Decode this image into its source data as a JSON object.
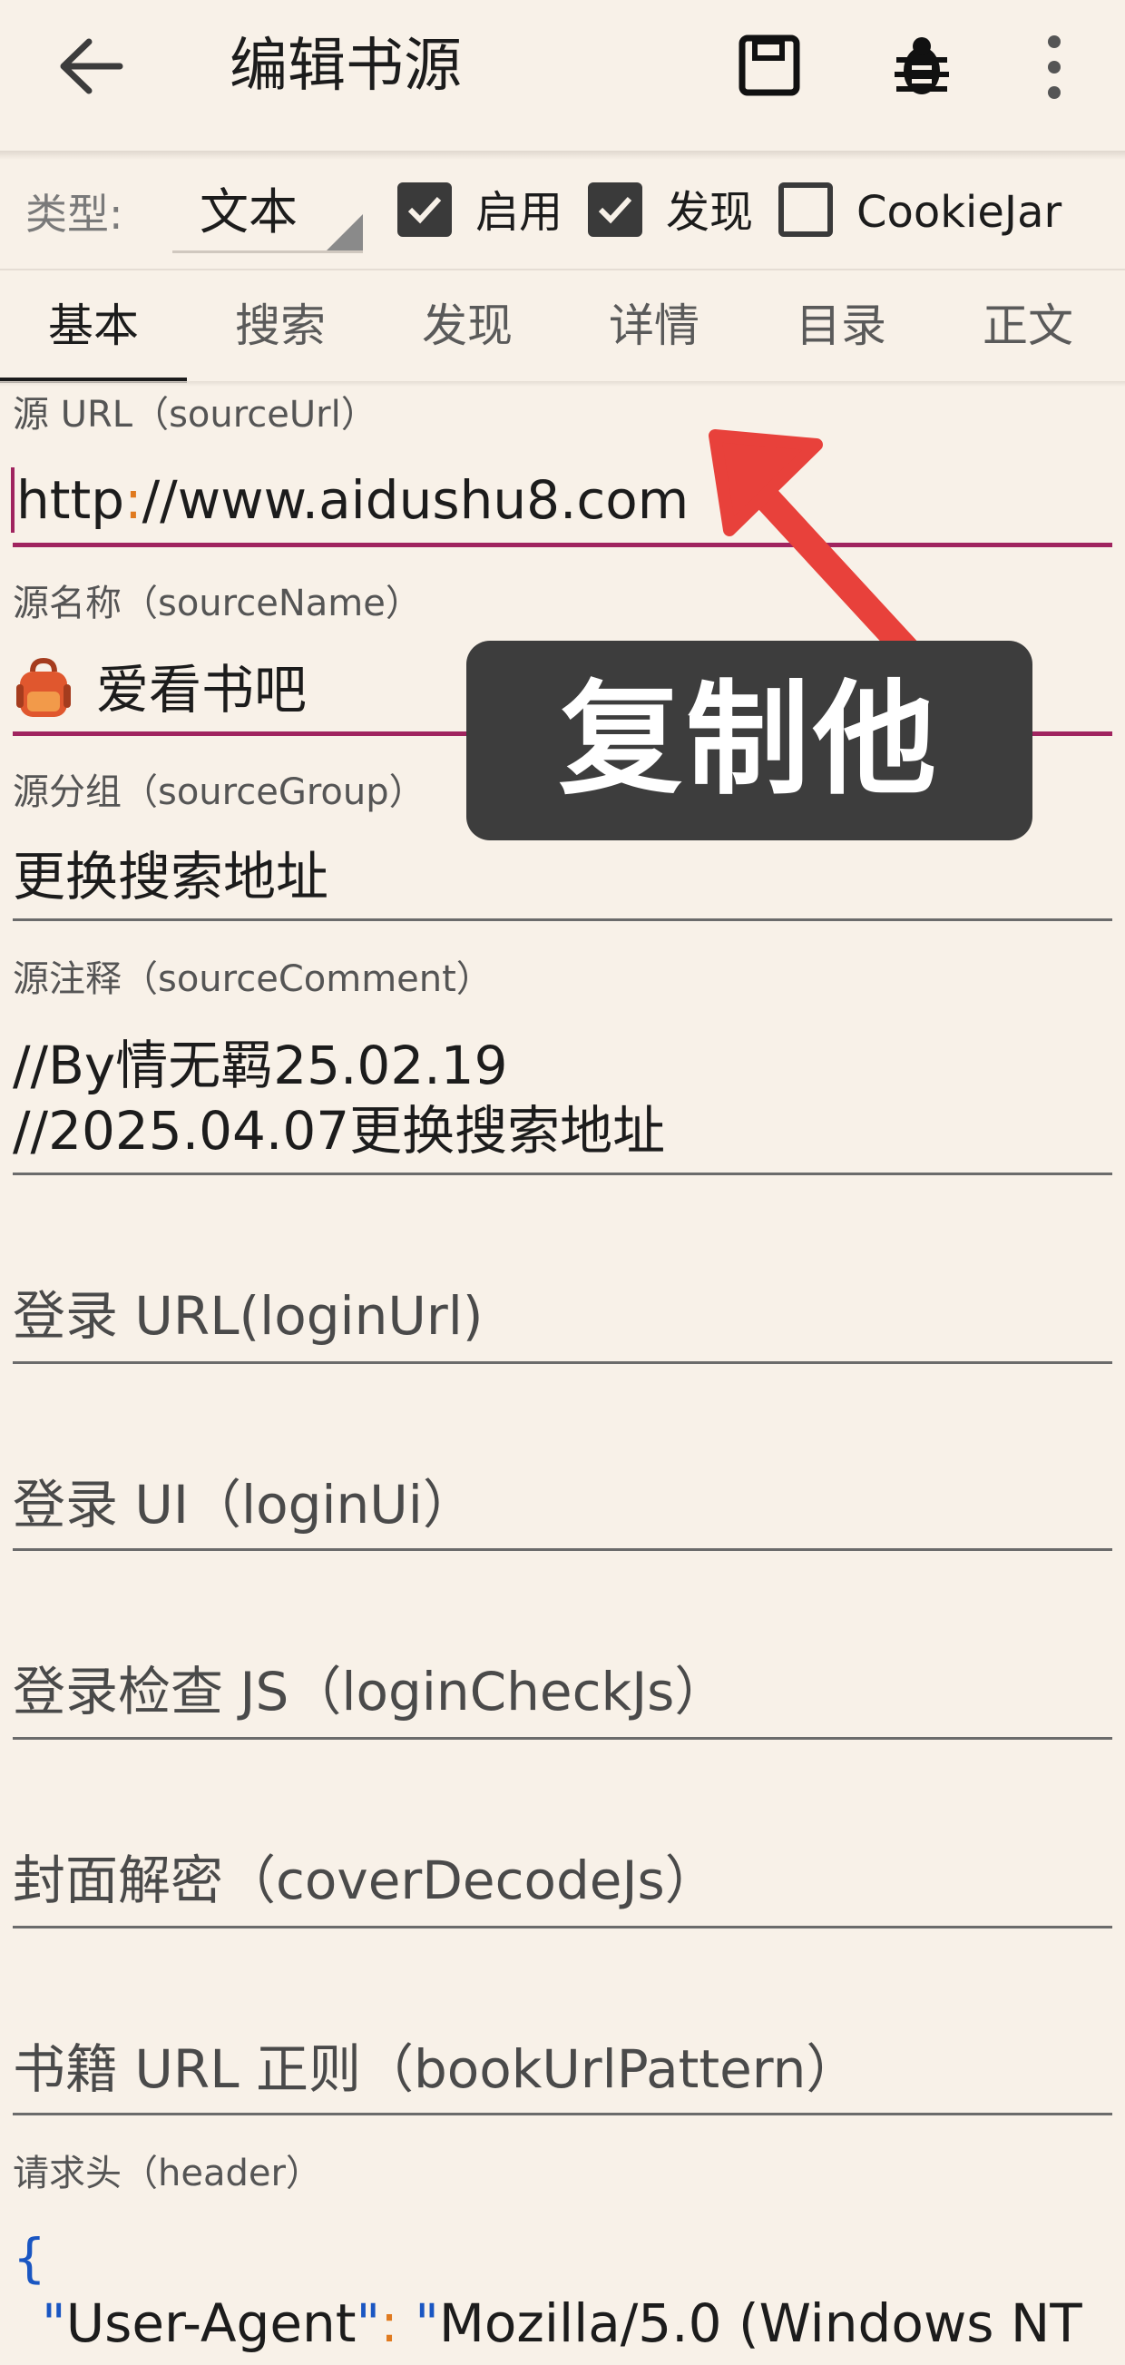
{
  "appbar": {
    "title": "编辑书源",
    "back_icon": "arrow-left-icon",
    "save_icon": "save-icon",
    "debug_icon": "bug-icon",
    "more_icon": "more-vertical-icon"
  },
  "type_row": {
    "label": "类型:",
    "selected": "文本",
    "checkboxes": [
      {
        "label": "启用",
        "checked": true
      },
      {
        "label": "发现",
        "checked": true
      },
      {
        "label": "CookieJar",
        "checked": false
      }
    ]
  },
  "tabs": [
    "基本",
    "搜索",
    "发现",
    "详情",
    "目录",
    "正文"
  ],
  "active_tab": "基本",
  "fields": {
    "source_url": {
      "label": "源 URL（sourceUrl）",
      "value_a": "http",
      "value_colon": ":",
      "value_b": "//www.aidushu8.com"
    },
    "source_name": {
      "label": "源名称（sourceName）",
      "value": "爱看书吧",
      "icon": "backpack-icon"
    },
    "source_group": {
      "label": "源分组（sourceGroup）",
      "value": "更换搜索地址"
    },
    "source_comment": {
      "label": "源注释（sourceComment）",
      "line1": "//By情无羁25.02.19",
      "line2": "//2025.04.07更换搜索地址"
    },
    "login_url": {
      "hint": "登录 URL(loginUrl)"
    },
    "login_ui": {
      "hint": "登录 UI（loginUi）"
    },
    "login_check_js": {
      "hint": "登录检查 JS（loginCheckJs）"
    },
    "cover_decode_js": {
      "hint": "封面解密（coverDecodeJs）"
    },
    "book_url_pattern": {
      "hint": "书籍 URL 正则（bookUrlPattern）"
    },
    "header": {
      "label": "请求头（header）",
      "open_brace": "{",
      "key": "User-Agent",
      "value_start": "Mozilla/5.0 (Windows NT"
    }
  },
  "annotation": {
    "text": "复制他",
    "arrow_color": "#e8413b"
  },
  "colors": {
    "background": "#f8f1e8",
    "focus_underline": "#a0245f",
    "json_brace": "#1a56c2",
    "json_punct": "#e07a1f"
  }
}
